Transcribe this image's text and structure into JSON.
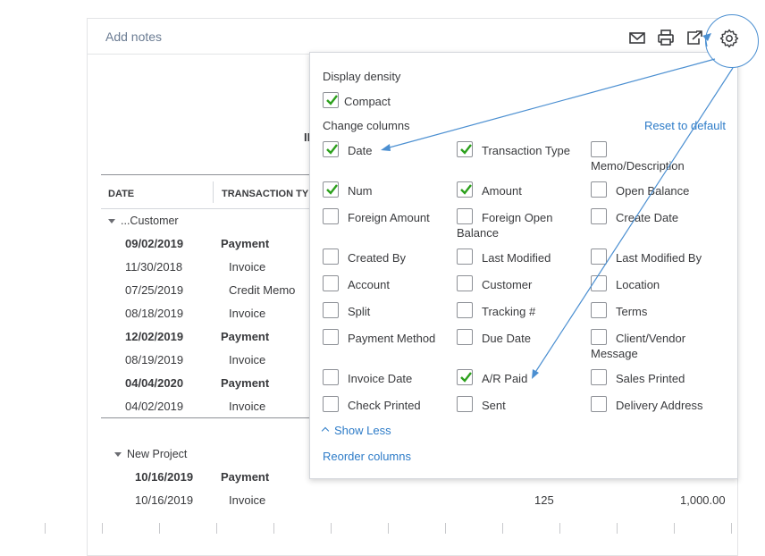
{
  "toolbar": {
    "add_notes": "Add notes",
    "icons": [
      "email-icon",
      "print-icon",
      "export-icon",
      "gear-icon"
    ]
  },
  "report": {
    "title_fragment": "II",
    "columns": [
      "DATE",
      "TRANSACTION TY"
    ],
    "groups": [
      {
        "name": "...Customer",
        "rows": [
          {
            "date": "09/02/2019",
            "type": "Payment",
            "bold": true
          },
          {
            "date": "11/30/2018",
            "type": "Invoice",
            "bold": false
          },
          {
            "date": "07/25/2019",
            "type": "Credit Memo",
            "bold": false
          },
          {
            "date": "08/18/2019",
            "type": "Invoice",
            "bold": false
          },
          {
            "date": "12/02/2019",
            "type": "Payment",
            "bold": true
          },
          {
            "date": "08/19/2019",
            "type": "Invoice",
            "bold": false
          },
          {
            "date": "04/04/2020",
            "type": "Payment",
            "bold": true
          },
          {
            "date": "04/02/2019",
            "type": "Invoice",
            "bold": false
          }
        ]
      },
      {
        "name": "New Project",
        "rows": [
          {
            "date": "10/16/2019",
            "type": "Payment",
            "bold": true
          },
          {
            "date": "10/16/2019",
            "type": "Invoice",
            "bold": false,
            "num": "125",
            "amount": "1,000.00"
          }
        ]
      }
    ]
  },
  "settings_panel": {
    "display_density_title": "Display density",
    "compact_label": "Compact",
    "compact_checked": true,
    "change_columns_title": "Change columns",
    "reset_label": "Reset to default",
    "columns": [
      {
        "label": "Date",
        "checked": true
      },
      {
        "label": "Transaction Type",
        "checked": true
      },
      {
        "label": "Memo/Description",
        "checked": false
      },
      {
        "label": "Num",
        "checked": true
      },
      {
        "label": "Amount",
        "checked": true
      },
      {
        "label": "Open Balance",
        "checked": false
      },
      {
        "label": "Foreign Amount",
        "checked": false
      },
      {
        "label": "Foreign Open",
        "label2": "Balance",
        "checked": false
      },
      {
        "label": "Create Date",
        "checked": false
      },
      {
        "label": "Created By",
        "checked": false
      },
      {
        "label": "Last Modified",
        "checked": false
      },
      {
        "label": "Last Modified By",
        "checked": false
      },
      {
        "label": "Account",
        "checked": false
      },
      {
        "label": "Customer",
        "checked": false
      },
      {
        "label": "Location",
        "checked": false
      },
      {
        "label": "Split",
        "checked": false
      },
      {
        "label": "Tracking #",
        "checked": false
      },
      {
        "label": "Terms",
        "checked": false
      },
      {
        "label": "Payment Method",
        "checked": false
      },
      {
        "label": "Due Date",
        "checked": false
      },
      {
        "label": "Client/Vendor",
        "label2": "Message",
        "checked": false
      },
      {
        "label": "Invoice Date",
        "checked": false
      },
      {
        "label": "A/R Paid",
        "checked": true
      },
      {
        "label": "Sales Printed",
        "checked": false
      },
      {
        "label": "Check Printed",
        "checked": false
      },
      {
        "label": "Sent",
        "checked": false
      },
      {
        "label": "Delivery Address",
        "checked": false
      }
    ],
    "show_less_label": "Show Less",
    "reorder_label": "Reorder columns"
  },
  "colors": {
    "link": "#2e7cc8",
    "check": "#2ca01c",
    "annotation": "#4b8fd1"
  }
}
